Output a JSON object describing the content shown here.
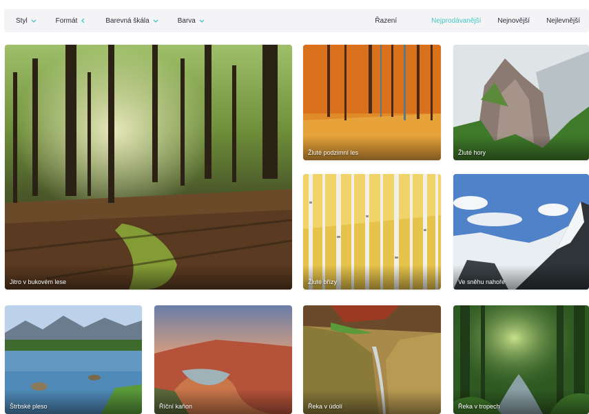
{
  "filters": [
    {
      "label": "Styl"
    },
    {
      "label": "Formát"
    },
    {
      "label": "Barevná škála"
    },
    {
      "label": "Barva"
    }
  ],
  "sort": {
    "label": "Řazení",
    "options": [
      "Nejprodávanější",
      "Nejnovější",
      "Nejlevnější"
    ],
    "active": "Nejprodávanější"
  },
  "colors": {
    "accent": "#3ec7c4"
  },
  "cards": [
    {
      "caption": "Jitro v bukovém lese"
    },
    {
      "caption": "Žluté podzimní les"
    },
    {
      "caption": "Žluté hory"
    },
    {
      "caption": "Žluté břízy"
    },
    {
      "caption": "Ve sněhu nahoře"
    },
    {
      "caption": "Štrbské pleso"
    },
    {
      "caption": "Říční kaňon"
    },
    {
      "caption": "Řeka v údolí"
    },
    {
      "caption": "Řeka v tropech"
    }
  ]
}
